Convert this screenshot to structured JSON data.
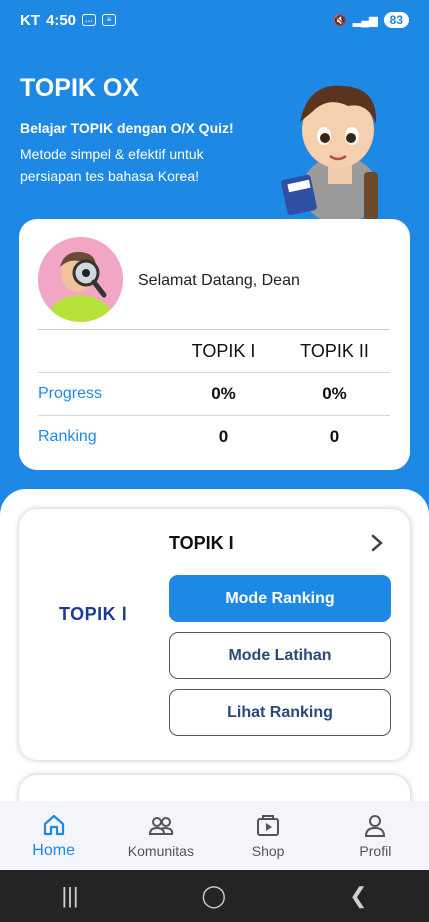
{
  "status_bar": {
    "carrier": "KT",
    "time": "4:50",
    "battery": "83"
  },
  "hero": {
    "title": "TOPIK OX",
    "subtitle": "Belajar TOPIK dengan O/X Quiz!",
    "description": "Metode simpel & efektif untuk persiapan tes bahasa Korea!"
  },
  "welcome": {
    "greeting": "Selamat Datang, Dean",
    "columns": [
      "TOPIK I",
      "TOPIK II"
    ],
    "rows": [
      {
        "label": "Progress",
        "values": [
          "0%",
          "0%"
        ]
      },
      {
        "label": "Ranking",
        "values": [
          "0",
          "0"
        ]
      }
    ]
  },
  "topik_card": {
    "logo": "TOPIK Ⅰ",
    "title": "TOPIK I",
    "buttons": {
      "ranking": "Mode Ranking",
      "practice": "Mode Latihan",
      "view_ranking": "Lihat Ranking"
    }
  },
  "bottom_nav": {
    "items": [
      {
        "label": "Home",
        "icon": "home-icon"
      },
      {
        "label": "Komunitas",
        "icon": "people-icon"
      },
      {
        "label": "Shop",
        "icon": "shop-icon"
      },
      {
        "label": "Profil",
        "icon": "person-icon"
      }
    ]
  },
  "colors": {
    "primary": "#1e88e5",
    "logo_navy": "#1a3c94",
    "avatar_bg": "#f2a6c6"
  }
}
